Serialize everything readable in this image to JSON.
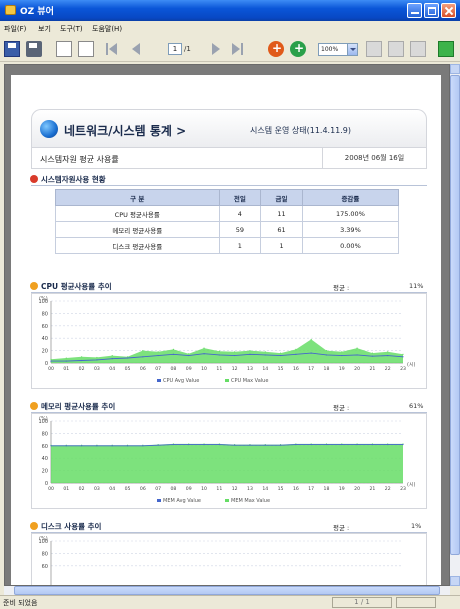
{
  "window": {
    "title": "OZ 뷰어"
  },
  "menu": [
    {
      "label": "파일(F)"
    },
    {
      "label": "보기"
    },
    {
      "label": "도구(T)"
    },
    {
      "label": "도움말(H)"
    }
  ],
  "toolbar": {
    "page_value": "1",
    "page_total": "/1",
    "zoom": "100%"
  },
  "report": {
    "title": "네트워크/시스템 통계 >",
    "subtitle": "시스템 운영 상태(11.4.11.9)",
    "summary_label": "시스템자원 평균 사용률",
    "date": "2008년 06월 16일",
    "usage_section": "시스템자원사용 현황",
    "usage_table": {
      "headers": [
        "구 분",
        "전일",
        "금일",
        "증감률"
      ],
      "rows": [
        [
          "CPU 평균사용률",
          "4",
          "11",
          "175.00%"
        ],
        [
          "메모리 평균사용률",
          "59",
          "61",
          "3.39%"
        ],
        [
          "디스크 평균사용률",
          "1",
          "1",
          "0.00%"
        ]
      ]
    },
    "cpu_section": {
      "title": "CPU 평균사용률 추이",
      "avg_label": "평균 :",
      "avg_value": "11%"
    },
    "mem_section": {
      "title": "메모리 평균사용률 추이",
      "avg_label": "평균 :",
      "avg_value": "61%"
    },
    "disk_section": {
      "title": "디스크 사용률 추이",
      "avg_label": "평균 :",
      "avg_value": "1%"
    }
  },
  "status": {
    "text": "준비 되었음",
    "page": "1 / 1"
  },
  "chart_data": [
    {
      "type": "area",
      "title": "CPU 평균사용률 추이",
      "ylabel": "(%)",
      "xlabel": "(시)",
      "ylim": [
        0,
        100
      ],
      "yticks": [
        0,
        20,
        40,
        60,
        80,
        100
      ],
      "x": [
        "00",
        "01",
        "02",
        "03",
        "04",
        "05",
        "06",
        "07",
        "08",
        "09",
        "10",
        "11",
        "12",
        "13",
        "14",
        "15",
        "16",
        "17",
        "18",
        "19",
        "20",
        "21",
        "22",
        "23"
      ],
      "series": [
        {
          "name": "CPU Avg Value",
          "color": "#4466cc",
          "values": [
            3,
            3,
            4,
            5,
            7,
            8,
            10,
            12,
            14,
            12,
            15,
            13,
            12,
            14,
            13,
            12,
            14,
            16,
            13,
            12,
            13,
            11,
            12,
            10
          ]
        },
        {
          "name": "CPU Max Value",
          "color": "#66dd66",
          "values": [
            6,
            8,
            10,
            9,
            12,
            10,
            20,
            18,
            22,
            15,
            24,
            19,
            18,
            20,
            18,
            16,
            22,
            38,
            20,
            18,
            24,
            16,
            18,
            14
          ]
        }
      ],
      "grid": true,
      "legend": "bottom"
    },
    {
      "type": "area",
      "title": "메모리 평균사용률 추이",
      "ylabel": "(%)",
      "xlabel": "(시)",
      "ylim": [
        0,
        100
      ],
      "yticks": [
        0,
        20,
        40,
        60,
        80,
        100
      ],
      "x": [
        "00",
        "01",
        "02",
        "03",
        "04",
        "05",
        "06",
        "07",
        "08",
        "09",
        "10",
        "11",
        "12",
        "13",
        "14",
        "15",
        "16",
        "17",
        "18",
        "19",
        "20",
        "21",
        "22",
        "23"
      ],
      "series": [
        {
          "name": "MEM Avg Value",
          "color": "#4466cc",
          "values": [
            60,
            60,
            60,
            60,
            60,
            60,
            60,
            61,
            62,
            62,
            62,
            62,
            61,
            61,
            61,
            61,
            62,
            62,
            62,
            62,
            62,
            62,
            62,
            62
          ]
        },
        {
          "name": "MEM Max Value",
          "color": "#66dd66",
          "values": [
            61,
            61,
            61,
            61,
            61,
            61,
            61,
            62,
            63,
            63,
            63,
            63,
            62,
            62,
            62,
            62,
            63,
            63,
            63,
            63,
            63,
            63,
            63,
            63
          ]
        }
      ],
      "grid": true,
      "legend": "bottom"
    },
    {
      "type": "area",
      "title": "디스크 사용률 추이",
      "ylabel": "(%)",
      "ylim": [
        0,
        100
      ],
      "yticks": [
        60,
        80,
        100
      ],
      "x": [],
      "series": [],
      "grid": true,
      "legend": "none"
    }
  ]
}
